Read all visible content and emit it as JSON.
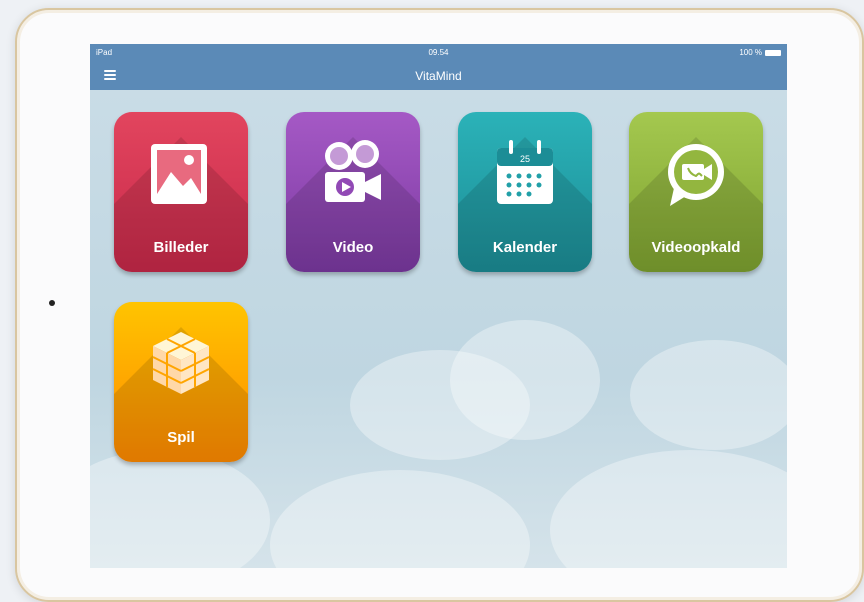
{
  "status_bar": {
    "device": "iPad",
    "time": "09.54",
    "battery": "100 %"
  },
  "header": {
    "title": "VitaMind"
  },
  "tiles": [
    {
      "label": "Billeder",
      "icon": "photo-icon",
      "color": "#d33552"
    },
    {
      "label": "Video",
      "icon": "video-camera-icon",
      "color": "#9149b5"
    },
    {
      "label": "Kalender",
      "icon": "calendar-icon",
      "color": "#22a0a8",
      "day": "25"
    },
    {
      "label": "Videoopkald",
      "icon": "video-call-icon",
      "color": "#93b63f"
    },
    {
      "label": "Spil",
      "icon": "cube-icon",
      "color": "#ffa500"
    }
  ]
}
